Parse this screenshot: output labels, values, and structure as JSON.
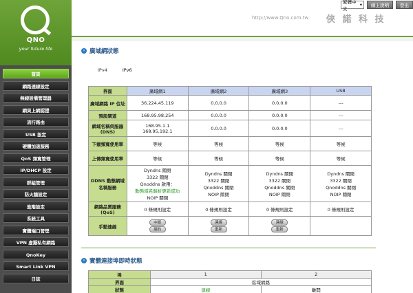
{
  "logo": {
    "brand": "QNO",
    "tagline": "your future life"
  },
  "nav": [
    {
      "label": "首頁",
      "active": true
    },
    {
      "label": "網路連線設定"
    },
    {
      "label": "無線設備管理器"
    },
    {
      "label": "網頁上網認證"
    },
    {
      "label": "流行路由"
    },
    {
      "label": "USB 設定"
    },
    {
      "label": "硬體加速服務"
    },
    {
      "label": "QoS 頻寬管理"
    },
    {
      "label": "IP/DHCP 設定"
    },
    {
      "label": "群組管理"
    },
    {
      "label": "防火牆設定"
    },
    {
      "label": "進階設定"
    },
    {
      "label": "系統工具"
    },
    {
      "label": "實體端口管理"
    },
    {
      "label": "VPN 虛擬私有網路"
    },
    {
      "label": "QnoKey"
    },
    {
      "label": "Smart Link VPN"
    },
    {
      "label": "日誌"
    }
  ],
  "header": {
    "language": "繁體中文",
    "help": "線上說明",
    "logout": "登出",
    "url": "http://www.Qno.com.tw",
    "brand_cn": "俠 諾 科 技"
  },
  "wan_section": {
    "title": "廣域網狀態",
    "tabs": [
      "IPv4",
      "IPv6"
    ],
    "columns": [
      "界面",
      "廣域網1",
      "廣域網2",
      "廣域網3",
      "USB"
    ],
    "rows": [
      {
        "key": "ip",
        "label": "廣域網路 IP 位址",
        "cells": [
          "36.224.45.119",
          "0.0.0.0",
          "0.0.0.0",
          "---"
        ]
      },
      {
        "key": "gw",
        "label": "預設閘道",
        "cells": [
          "168.95.98.254",
          "0.0.0.0",
          "0.0.0.0",
          "---"
        ]
      },
      {
        "key": "dns",
        "label": "網域名稱伺服器(DNS)",
        "cells": [
          "168.95.1.1\n168.95.192.1",
          "0.0.0.0",
          "0.0.0.0",
          "---"
        ]
      },
      {
        "key": "down",
        "label": "下載頻寬使用率",
        "cells": [
          "等候",
          "等候",
          "等候",
          "等候"
        ]
      },
      {
        "key": "up",
        "label": "上傳頻寬使用率",
        "cells": [
          "等候",
          "等候",
          "等候",
          "等候"
        ]
      },
      {
        "key": "ddns",
        "label": "DDNS 動態網域名稱服務",
        "wan1": {
          "l1": "Dyndns 關閉",
          "l2": "3322 關閉",
          "l3": "Qnoddns 啟用：",
          "l4": "動態域名解析更新成功",
          "l5": "NOIP 關閉"
        },
        "cells_other": [
          "Dyndns 關閉\n3322 關閉\nQnoddns 關閉\nNOIP 關閉",
          "Dyndns 關閉\n3322 關閉\nQnoddns 關閉\nNOIP 關閉",
          "Dyndns 關閉\n3322 關閉\nQnoddns 關閉\nNOIP 關閉"
        ]
      },
      {
        "key": "qos",
        "label": "網路品質服務(QoS)",
        "cells": [
          "0 條規則設定",
          "0 條規則設定",
          "0 條規則設定",
          "0 條規則設定"
        ]
      },
      {
        "key": "btn",
        "label": "手動連線"
      }
    ],
    "buttons": {
      "wan1": [
        "中斷",
        "續約"
      ],
      "wan2": [
        "連線",
        "重新"
      ],
      "wan3": [
        "連線",
        "重新"
      ]
    }
  },
  "port_section": {
    "title": "實體連接埠即時狀態",
    "col_head": "埠",
    "ports": [
      "1",
      "2"
    ],
    "row2_label": "界面",
    "row2_value": "區域網路",
    "row3_label": "狀態",
    "row3_values": [
      "連線",
      "離開"
    ]
  }
}
